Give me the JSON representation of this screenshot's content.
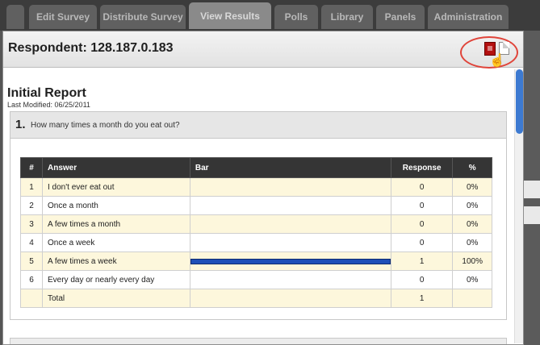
{
  "tabs": [
    "Edit Survey",
    "Distribute Survey",
    "View Results",
    "Polls",
    "Library",
    "Panels",
    "Administration"
  ],
  "active_tab": "View Results",
  "modal": {
    "title": "Respondent: 128.187.0.183",
    "export_icon": "pdf-icon",
    "doc_icon": "document-icon"
  },
  "report": {
    "title": "Initial Report",
    "modified": "Last Modified: 06/25/2011"
  },
  "question": {
    "number": "1.",
    "text": "How many times a month do you eat out?"
  },
  "table": {
    "headers": [
      "#",
      "Answer",
      "Bar",
      "Response",
      "%"
    ],
    "rows": [
      {
        "num": "1",
        "answer": "I don't ever eat out",
        "response": "0",
        "pct": "0%",
        "fraction": 0
      },
      {
        "num": "2",
        "answer": "Once a month",
        "response": "0",
        "pct": "0%",
        "fraction": 0
      },
      {
        "num": "3",
        "answer": "A few times a month",
        "response": "0",
        "pct": "0%",
        "fraction": 0
      },
      {
        "num": "4",
        "answer": "Once a week",
        "response": "0",
        "pct": "0%",
        "fraction": 0
      },
      {
        "num": "5",
        "answer": "A few times a week",
        "response": "1",
        "pct": "100%",
        "fraction": 1
      },
      {
        "num": "6",
        "answer": "Every day or nearly every day",
        "response": "0",
        "pct": "0%",
        "fraction": 0
      }
    ],
    "total_label": "Total",
    "total_value": "1"
  },
  "colors": {
    "bar": "#1e4fb8",
    "header_bg": "#353535",
    "highlight_ring": "#e0443a"
  }
}
